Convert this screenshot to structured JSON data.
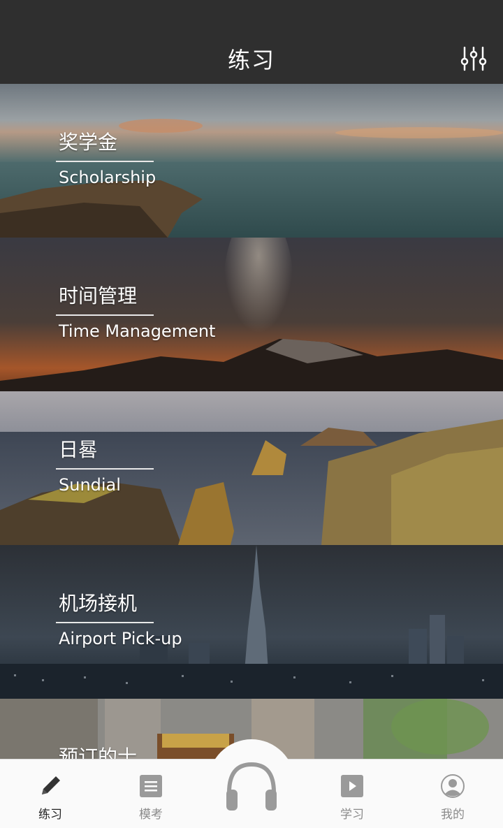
{
  "header": {
    "title": "练习"
  },
  "cards": [
    {
      "zh": "奖学金",
      "en": "Scholarship"
    },
    {
      "zh": "时间管理",
      "en": "Time Management"
    },
    {
      "zh": "日晷",
      "en": "Sundial"
    },
    {
      "zh": "机场接机",
      "en": "Airport Pick-up"
    },
    {
      "zh": "预订的士",
      "en": ""
    }
  ],
  "tabs": [
    {
      "label": "练习",
      "icon": "pencil-icon"
    },
    {
      "label": "模考",
      "icon": "document-list-icon"
    },
    {
      "label": "学习",
      "icon": "play-icon"
    },
    {
      "label": "我的",
      "icon": "profile-icon"
    }
  ],
  "center_button": {
    "icon": "headphones-icon"
  },
  "colors": {
    "header_bg": "#2f2f2f",
    "tabbar_bg": "#fafafa",
    "active_tab": "#222222",
    "inactive_tab": "#8a8a8a"
  }
}
